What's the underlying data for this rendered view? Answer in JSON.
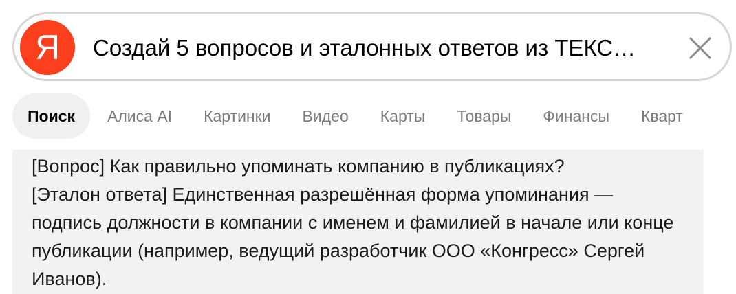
{
  "search": {
    "logo_letter": "Я",
    "query": "Создай 5 вопросов и эталонных ответов из ТЕКС…"
  },
  "tabs": [
    {
      "label": "Поиск",
      "active": true
    },
    {
      "label": "Алиса AI"
    },
    {
      "label": "Картинки"
    },
    {
      "label": "Видео"
    },
    {
      "label": "Карты"
    },
    {
      "label": "Товары"
    },
    {
      "label": "Финансы"
    },
    {
      "label": "Кварт"
    }
  ],
  "answer": {
    "question": "[Вопрос] Как правильно упоминать компанию в публикациях?",
    "reference": "[Эталон ответа] Единственная разрешённая форма упоминания — подпись должности в компании с именем и фамилией в начале или конце публикации (например, ведущий разработчик ООО «Конгресс» Сергей Иванов)."
  },
  "colors": {
    "logo": "#fc3f1d",
    "active_tab_bg": "#f0f0f0",
    "answer_bg": "#f2f2f2"
  }
}
